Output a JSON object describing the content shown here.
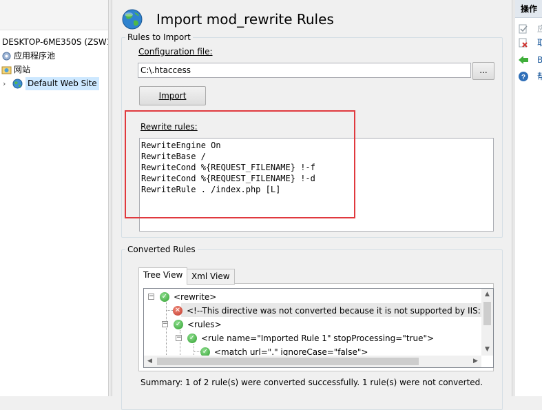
{
  "connections": {
    "server": "DESKTOP-6ME350S (ZSW1",
    "app_pools": "应用程序池",
    "sites": "网站",
    "default_site": "Default Web Site"
  },
  "page": {
    "title": "Import mod_rewrite Rules"
  },
  "rules_to_import": {
    "legend": "Rules to Import",
    "config_label": "Configuration file:",
    "config_value": "C:\\.htaccess",
    "browse_label": "...",
    "import_label": "Import",
    "rewrite_label": "Rewrite rules:",
    "rewrite_text": "RewriteEngine On\nRewriteBase /\nRewriteCond %{REQUEST_FILENAME} !-f\nRewriteCond %{REQUEST_FILENAME} !-d\nRewriteRule . /index.php [L]"
  },
  "converted_rules": {
    "legend": "Converted Rules",
    "tabs": [
      "Tree View",
      "Xml View"
    ],
    "tree": [
      "<rewrite>",
      "<!--This directive was not converted because it is not supported by IIS: R",
      "<rules>",
      "<rule name=\"Imported Rule 1\" stopProcessing=\"true\">",
      "<match url=\".\" ignoreCase=\"false\">"
    ],
    "summary": "Summary: 1 of 2 rule(s) were converted successfully. 1 rule(s) were not converted."
  },
  "actions": {
    "header": "操作",
    "items": [
      "应",
      "取",
      "B",
      "帮"
    ]
  },
  "colors": {
    "highlight": "#e0393e",
    "link": "#1c5a9c",
    "success": "#2f9e2f",
    "error": "#c0392b"
  }
}
